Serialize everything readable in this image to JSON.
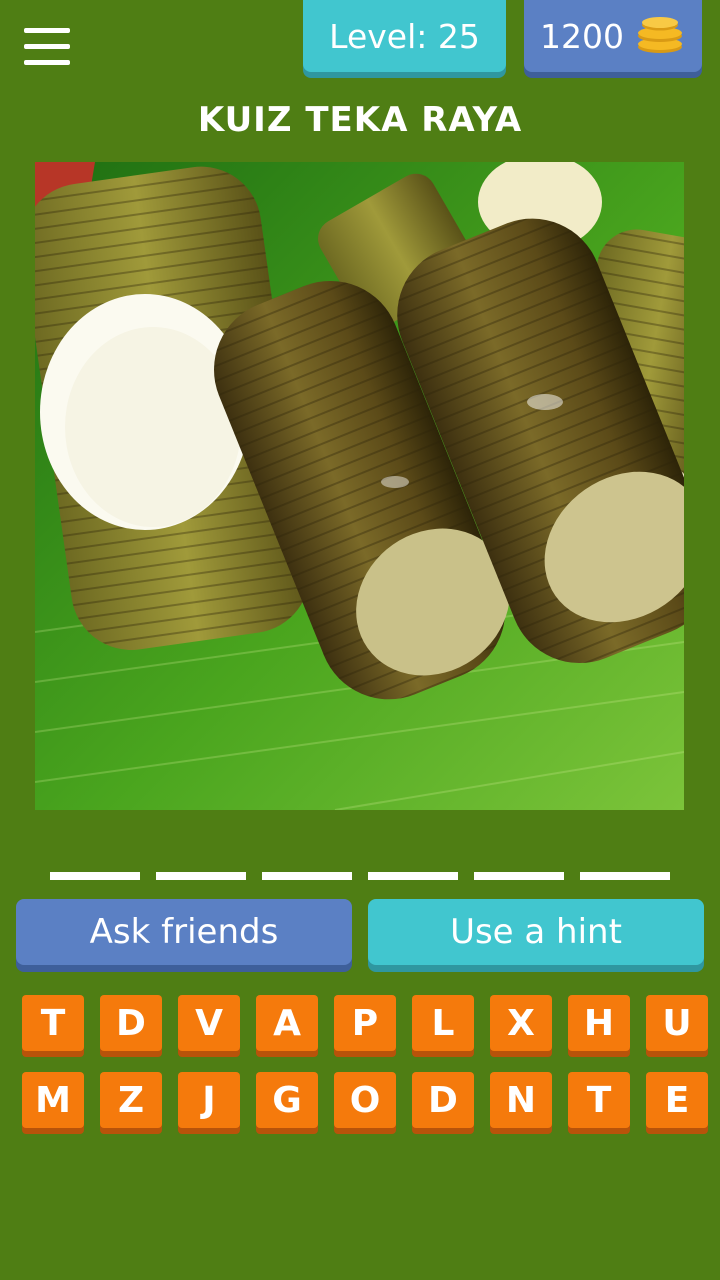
{
  "header": {
    "menu_icon": "hamburger-menu-icon",
    "level_label": "Level: 25",
    "coins": "1200",
    "coin_icon": "coin-stack-icon"
  },
  "title": "KUIZ TEKA RAYA",
  "puzzle_image": "Photo of lemang: glutinous rice rolls wrapped in banana leaves on a green banana leaf",
  "answer_slots": 6,
  "buttons": {
    "ask_friends": "Ask friends",
    "use_hint": "Use a hint"
  },
  "keyboard": {
    "row1": [
      "T",
      "D",
      "V",
      "A",
      "P",
      "L",
      "X",
      "H",
      "U"
    ],
    "row2": [
      "M",
      "Z",
      "J",
      "G",
      "O",
      "D",
      "N",
      "T",
      "E"
    ]
  },
  "colors": {
    "background": "#4f7e14",
    "cyan": "#41c6cf",
    "blue": "#5b80c4",
    "orange": "#f57a0c"
  }
}
